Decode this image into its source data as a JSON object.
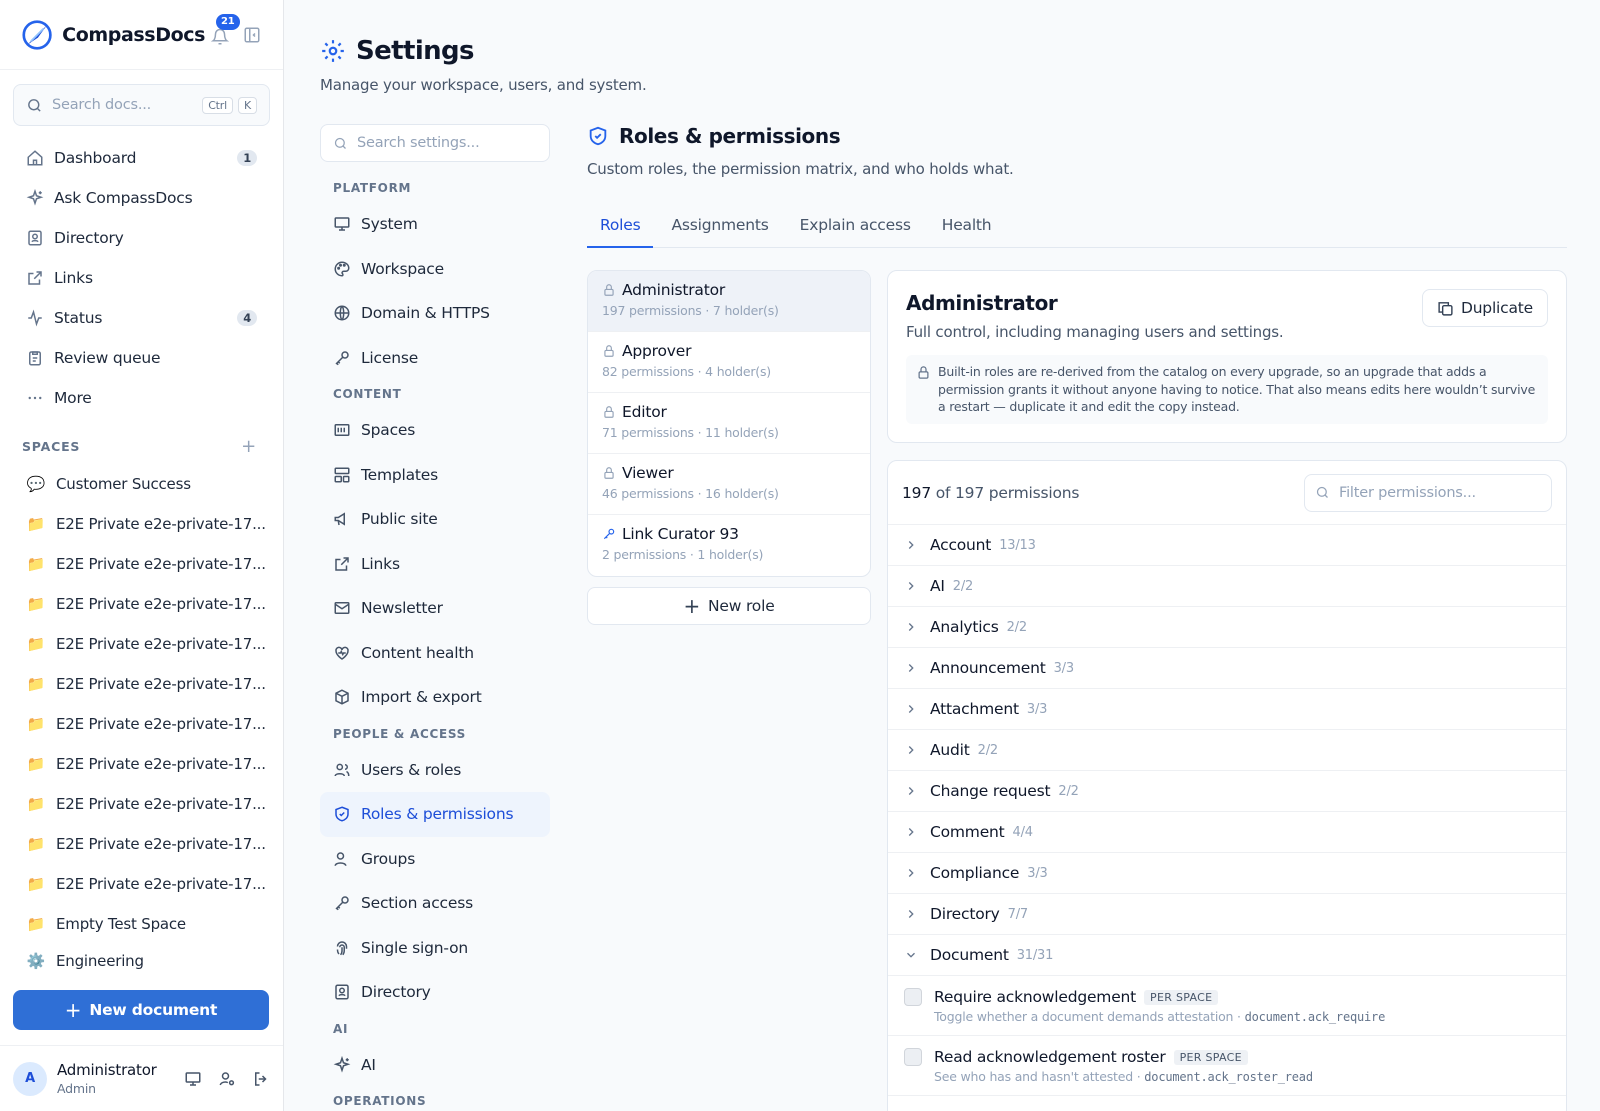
{
  "brand": {
    "name": "CompassDocs",
    "notifications": "21"
  },
  "search": {
    "placeholder": "Search docs...",
    "kbd1": "Ctrl",
    "kbd2": "K"
  },
  "nav": [
    {
      "label": "Dashboard",
      "icon": "home-icon",
      "badge": "1"
    },
    {
      "label": "Ask CompassDocs",
      "icon": "sparkles-icon",
      "badge": ""
    },
    {
      "label": "Directory",
      "icon": "contact-book-icon",
      "badge": ""
    },
    {
      "label": "Links",
      "icon": "external-link-icon",
      "badge": ""
    },
    {
      "label": "Status",
      "icon": "activity-icon",
      "badge": "4"
    },
    {
      "label": "Review queue",
      "icon": "clipboard-icon",
      "badge": ""
    },
    {
      "label": "More",
      "icon": "dots-icon",
      "badge": ""
    }
  ],
  "spaces": {
    "heading": "SPACES",
    "items": [
      {
        "label": "Customer Success",
        "icon": "💬"
      },
      {
        "label": "E2E Private e2e-private-17...",
        "icon": "📁"
      },
      {
        "label": "E2E Private e2e-private-17...",
        "icon": "📁"
      },
      {
        "label": "E2E Private e2e-private-17...",
        "icon": "📁"
      },
      {
        "label": "E2E Private e2e-private-17...",
        "icon": "📁"
      },
      {
        "label": "E2E Private e2e-private-17...",
        "icon": "📁"
      },
      {
        "label": "E2E Private e2e-private-17...",
        "icon": "📁"
      },
      {
        "label": "E2E Private e2e-private-17...",
        "icon": "📁"
      },
      {
        "label": "E2E Private e2e-private-17...",
        "icon": "📁"
      },
      {
        "label": "E2E Private e2e-private-17...",
        "icon": "📁"
      },
      {
        "label": "E2E Private e2e-private-17...",
        "icon": "📁"
      },
      {
        "label": "Empty Test Space",
        "icon": "📁"
      },
      {
        "label": "Engineering",
        "icon": "⚙️"
      }
    ]
  },
  "new_document": "New document",
  "user": {
    "initial": "A",
    "name": "Administrator",
    "role": "Admin"
  },
  "page": {
    "title": "Settings",
    "subtitle": "Manage your workspace, users, and system."
  },
  "settings_search": {
    "placeholder": "Search settings..."
  },
  "settings_nav": {
    "platform": {
      "heading": "PLATFORM",
      "items": [
        "System",
        "Workspace",
        "Domain & HTTPS",
        "License"
      ]
    },
    "content": {
      "heading": "CONTENT",
      "items": [
        "Spaces",
        "Templates",
        "Public site",
        "Links",
        "Newsletter",
        "Content health",
        "Import & export"
      ]
    },
    "people": {
      "heading": "PEOPLE & ACCESS",
      "items": [
        "Users & roles",
        "Roles & permissions",
        "Groups",
        "Section access",
        "Single sign-on",
        "Directory"
      ]
    },
    "ai": {
      "heading": "AI",
      "items": [
        "AI"
      ]
    },
    "operations": {
      "heading": "OPERATIONS"
    }
  },
  "section": {
    "title": "Roles & permissions",
    "subtitle": "Custom roles, the permission matrix, and who holds what."
  },
  "tabs": [
    "Roles",
    "Assignments",
    "Explain access",
    "Health"
  ],
  "roles": [
    {
      "name": "Administrator",
      "meta": "197 permissions · 7 holder(s)",
      "icon": "lock-icon"
    },
    {
      "name": "Approver",
      "meta": "82 permissions · 4 holder(s)",
      "icon": "lock-icon"
    },
    {
      "name": "Editor",
      "meta": "71 permissions · 11 holder(s)",
      "icon": "lock-icon"
    },
    {
      "name": "Viewer",
      "meta": "46 permissions · 16 holder(s)",
      "icon": "lock-icon"
    },
    {
      "name": "Link Curator 93",
      "meta": "2 permissions · 1 holder(s)",
      "icon": "key-icon"
    }
  ],
  "new_role": "New role",
  "detail": {
    "title": "Administrator",
    "description": "Full control, including managing users and settings.",
    "duplicate": "Duplicate",
    "note": "Built-in roles are re-derived from the catalog on every upgrade, so an upgrade that adds a permission grants it without anyone having to notice. That also means edits here wouldn’t survive a restart — duplicate it and edit the copy instead."
  },
  "permissions": {
    "count": "197",
    "count_suffix": "of 197 permissions",
    "filter_placeholder": "Filter permissions...",
    "categories": [
      {
        "name": "Account",
        "count": "13/13"
      },
      {
        "name": "AI",
        "count": "2/2"
      },
      {
        "name": "Analytics",
        "count": "2/2"
      },
      {
        "name": "Announcement",
        "count": "3/3"
      },
      {
        "name": "Attachment",
        "count": "3/3"
      },
      {
        "name": "Audit",
        "count": "2/2"
      },
      {
        "name": "Change request",
        "count": "2/2"
      },
      {
        "name": "Comment",
        "count": "4/4"
      },
      {
        "name": "Compliance",
        "count": "3/3"
      },
      {
        "name": "Directory",
        "count": "7/7"
      },
      {
        "name": "Document",
        "count": "31/31"
      }
    ],
    "items": [
      {
        "name": "Require acknowledgement",
        "scope": "PER SPACE",
        "desc": "Toggle whether a document demands attestation ·",
        "code": "document.ack_require"
      },
      {
        "name": "Read acknowledgement roster",
        "scope": "PER SPACE",
        "desc": "See who has and hasn't attested ·",
        "code": "document.ack_roster_read"
      }
    ]
  }
}
